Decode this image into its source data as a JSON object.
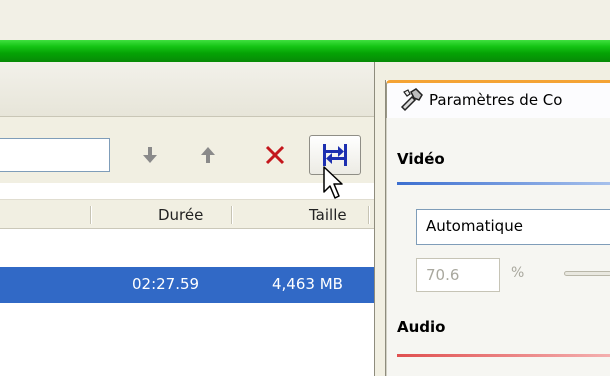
{
  "toolbar": {
    "search_value": "",
    "icons": [
      "arrow-down-icon",
      "arrow-up-icon",
      "delete-x-icon",
      "swap-columns-icon"
    ]
  },
  "list": {
    "columns": {
      "duration": "Durée",
      "size": "Taille"
    },
    "rows": [
      {
        "duration": "02:27.59",
        "size": "4,463 MB",
        "selected": true
      }
    ]
  },
  "settings_panel": {
    "tab_title": "Paramètres de Co",
    "video": {
      "heading": "Vidéo",
      "mode_value": "Automatique",
      "quality_value": "70.6",
      "quality_unit": "%"
    },
    "audio": {
      "heading": "Audio"
    }
  },
  "colors": {
    "selection": "#3169c6",
    "delete": "#c4161c",
    "video_rule": "#3c6fd0",
    "audio_rule": "#e05050",
    "progress_green": "#0fb80f"
  }
}
